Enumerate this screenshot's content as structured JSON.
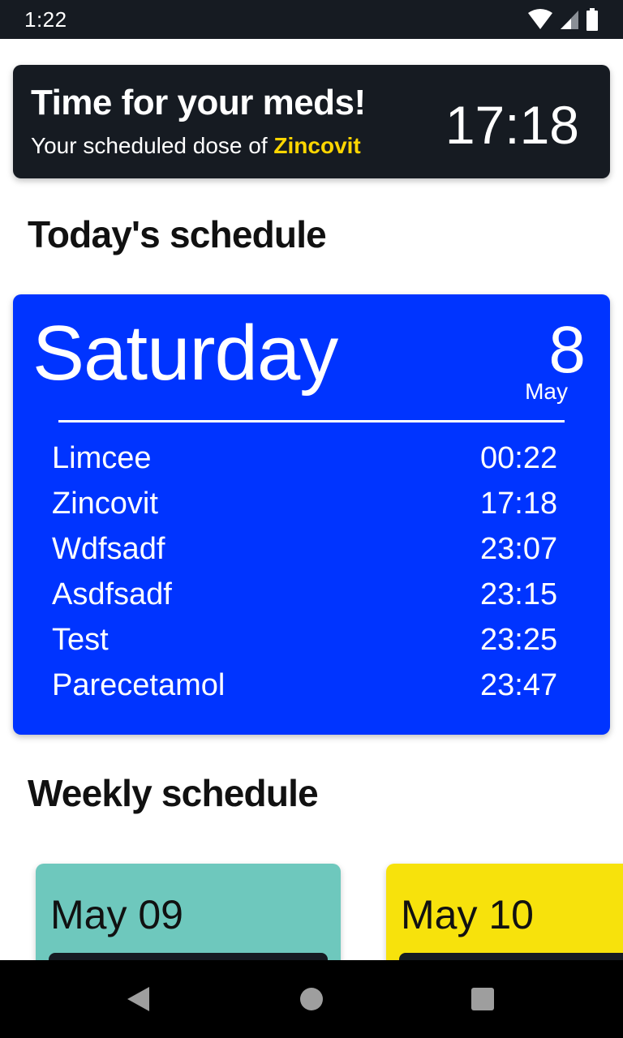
{
  "status_bar": {
    "time": "1:22",
    "icons": [
      "wifi-icon",
      "cell-signal-icon",
      "battery-icon"
    ]
  },
  "reminder": {
    "title": "Time for your meds!",
    "subtitle_prefix": "Your scheduled dose of ",
    "medicine": "Zincovit",
    "time": "17:18"
  },
  "today_section": {
    "title": "Today's schedule",
    "day_name": "Saturday",
    "day_number": "8",
    "month": "May",
    "doses": [
      {
        "name": "Limcee",
        "time": "00:22"
      },
      {
        "name": "Zincovit",
        "time": "17:18"
      },
      {
        "name": "Wdfsadf",
        "time": "23:07"
      },
      {
        "name": "Asdfsadf",
        "time": "23:15"
      },
      {
        "name": "Test",
        "time": "23:25"
      },
      {
        "name": "Parecetamol",
        "time": "23:47"
      }
    ]
  },
  "weekly_section": {
    "title": "Weekly schedule",
    "days": [
      {
        "date": "May 09",
        "color": "#6ec8bd"
      },
      {
        "date": "May 10",
        "color": "#f7e20c"
      }
    ]
  },
  "nav_bar": {
    "icons": [
      "back-icon",
      "home-icon",
      "recents-icon"
    ]
  },
  "colors": {
    "dark": "#161b22",
    "accent_yellow": "#ffd600",
    "today_blue": "#0034ff"
  }
}
